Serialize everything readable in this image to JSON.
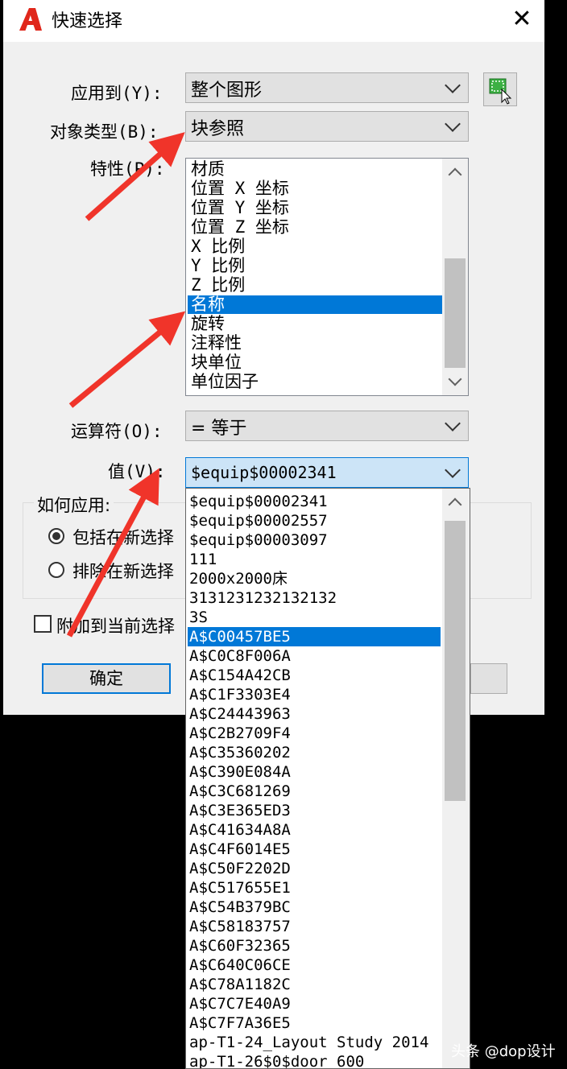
{
  "window": {
    "title": "快速选择",
    "close": "✕"
  },
  "fields": {
    "apply_to": {
      "label": "应用到(Y):",
      "value": "整个图形"
    },
    "object_type": {
      "label": "对象类型(B):",
      "value": "块参照"
    },
    "properties": {
      "label": "特性(P):",
      "items": [
        "材质",
        "位置 X 坐标",
        "位置 Y 坐标",
        "位置 Z 坐标",
        "X 比例",
        "Y 比例",
        "Z 比例",
        "名称",
        "旋转",
        "注释性",
        "块单位",
        "单位因子"
      ],
      "selected": "名称"
    },
    "operator": {
      "label": "运算符(O):",
      "value": "= 等于"
    },
    "value": {
      "label": "值(V):",
      "value": "$equip$00002341"
    }
  },
  "how_to_apply": {
    "label": "如何应用:",
    "include": "包括在新选择",
    "exclude": "排除在新选择",
    "selected": "include"
  },
  "append": {
    "label": "附加到当前选择",
    "checked": false
  },
  "buttons": {
    "ok": "确定"
  },
  "value_dropdown": {
    "items": [
      "$equip$00002341",
      "$equip$00002557",
      "$equip$00003097",
      "111",
      "2000x2000床",
      "3131231232132132",
      "3S",
      "A$C00457BE5",
      "A$C0C8F006A",
      "A$C154A42CB",
      "A$C1F3303E4",
      "A$C24443963",
      "A$C2B2709F4",
      "A$C35360202",
      "A$C390E084A",
      "A$C3C681269",
      "A$C3E365ED3",
      "A$C41634A8A",
      "A$C4F6014E5",
      "A$C50F2202D",
      "A$C517655E1",
      "A$C54B379BC",
      "A$C58183757",
      "A$C60F32365",
      "A$C640C06CE",
      "A$C78A1182C",
      "A$C7C7E40A9",
      "A$C7F7A36E5",
      "ap-T1-24_Layout Study 2014",
      "ap-T1-26$0$door 600"
    ],
    "selected": "A$C00457BE5"
  },
  "watermark": "头条 @dop设计",
  "colors": {
    "selection": "#0078d7",
    "arrow": "#f0342a",
    "logo": "#e0271b"
  }
}
